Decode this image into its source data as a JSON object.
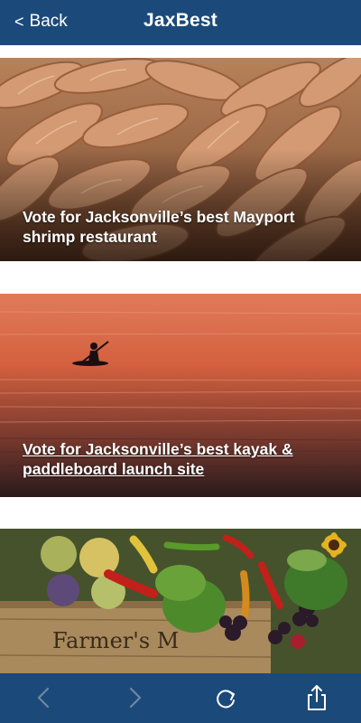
{
  "header": {
    "back_label": "Back",
    "back_icon": "chevron-left-icon",
    "title": "JaxBest"
  },
  "articles": [
    {
      "headline": "Vote for Jacksonville’s best Mayport shrimp restaurant",
      "image": "shrimp-pile-photo"
    },
    {
      "headline": "Vote for Jacksonville’s best kayak & paddleboard launch site",
      "image": "kayak-sunset-photo"
    },
    {
      "headline": "",
      "image": "farmers-market-vegetables-photo",
      "image_text": "Farmer's M"
    }
  ],
  "toolbar": {
    "icons": [
      "back-arrow-icon",
      "forward-arrow-icon",
      "reload-icon",
      "share-icon"
    ]
  },
  "colors": {
    "bar": "#1b4a7a",
    "icon_disabled": "#6f86a3",
    "icon_enabled": "#ffffff"
  }
}
